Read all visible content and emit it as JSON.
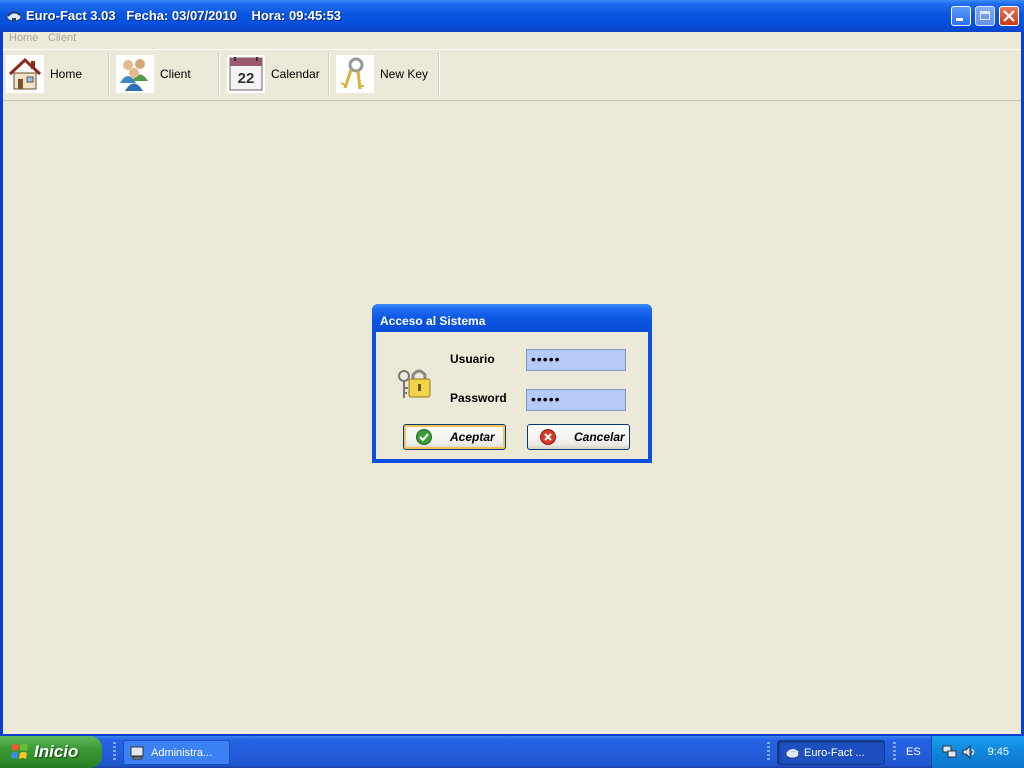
{
  "window": {
    "title": "Euro-Fact 3.03   Fecha: 03/07/2010    Hora: 09:45:53"
  },
  "menubar": {
    "items": [
      {
        "label": "Home"
      },
      {
        "label": "Client"
      }
    ]
  },
  "toolbar": {
    "items": [
      {
        "label": "Home",
        "icon": "house-icon"
      },
      {
        "label": "Client",
        "icon": "users-icon"
      },
      {
        "label": "Calendar",
        "icon": "calendar-icon",
        "day": "22"
      },
      {
        "label": "New Key",
        "icon": "keys-icon"
      }
    ]
  },
  "dialog": {
    "title": "Acceso al Sistema",
    "user_label": "Usuario",
    "user_value": "•••••",
    "password_label": "Password",
    "password_value": "•••••",
    "ok_label": "Aceptar",
    "cancel_label": "Cancelar"
  },
  "taskbar": {
    "start_label": "Inicio",
    "tasks": [
      {
        "label": "Administra..."
      },
      {
        "label": "Euro-Fact ..."
      }
    ],
    "language": "ES",
    "clock": "9:45"
  },
  "colors": {
    "titlebar": "#0a55e0",
    "face": "#ece9d8",
    "field_bg": "#b6c9f8"
  }
}
